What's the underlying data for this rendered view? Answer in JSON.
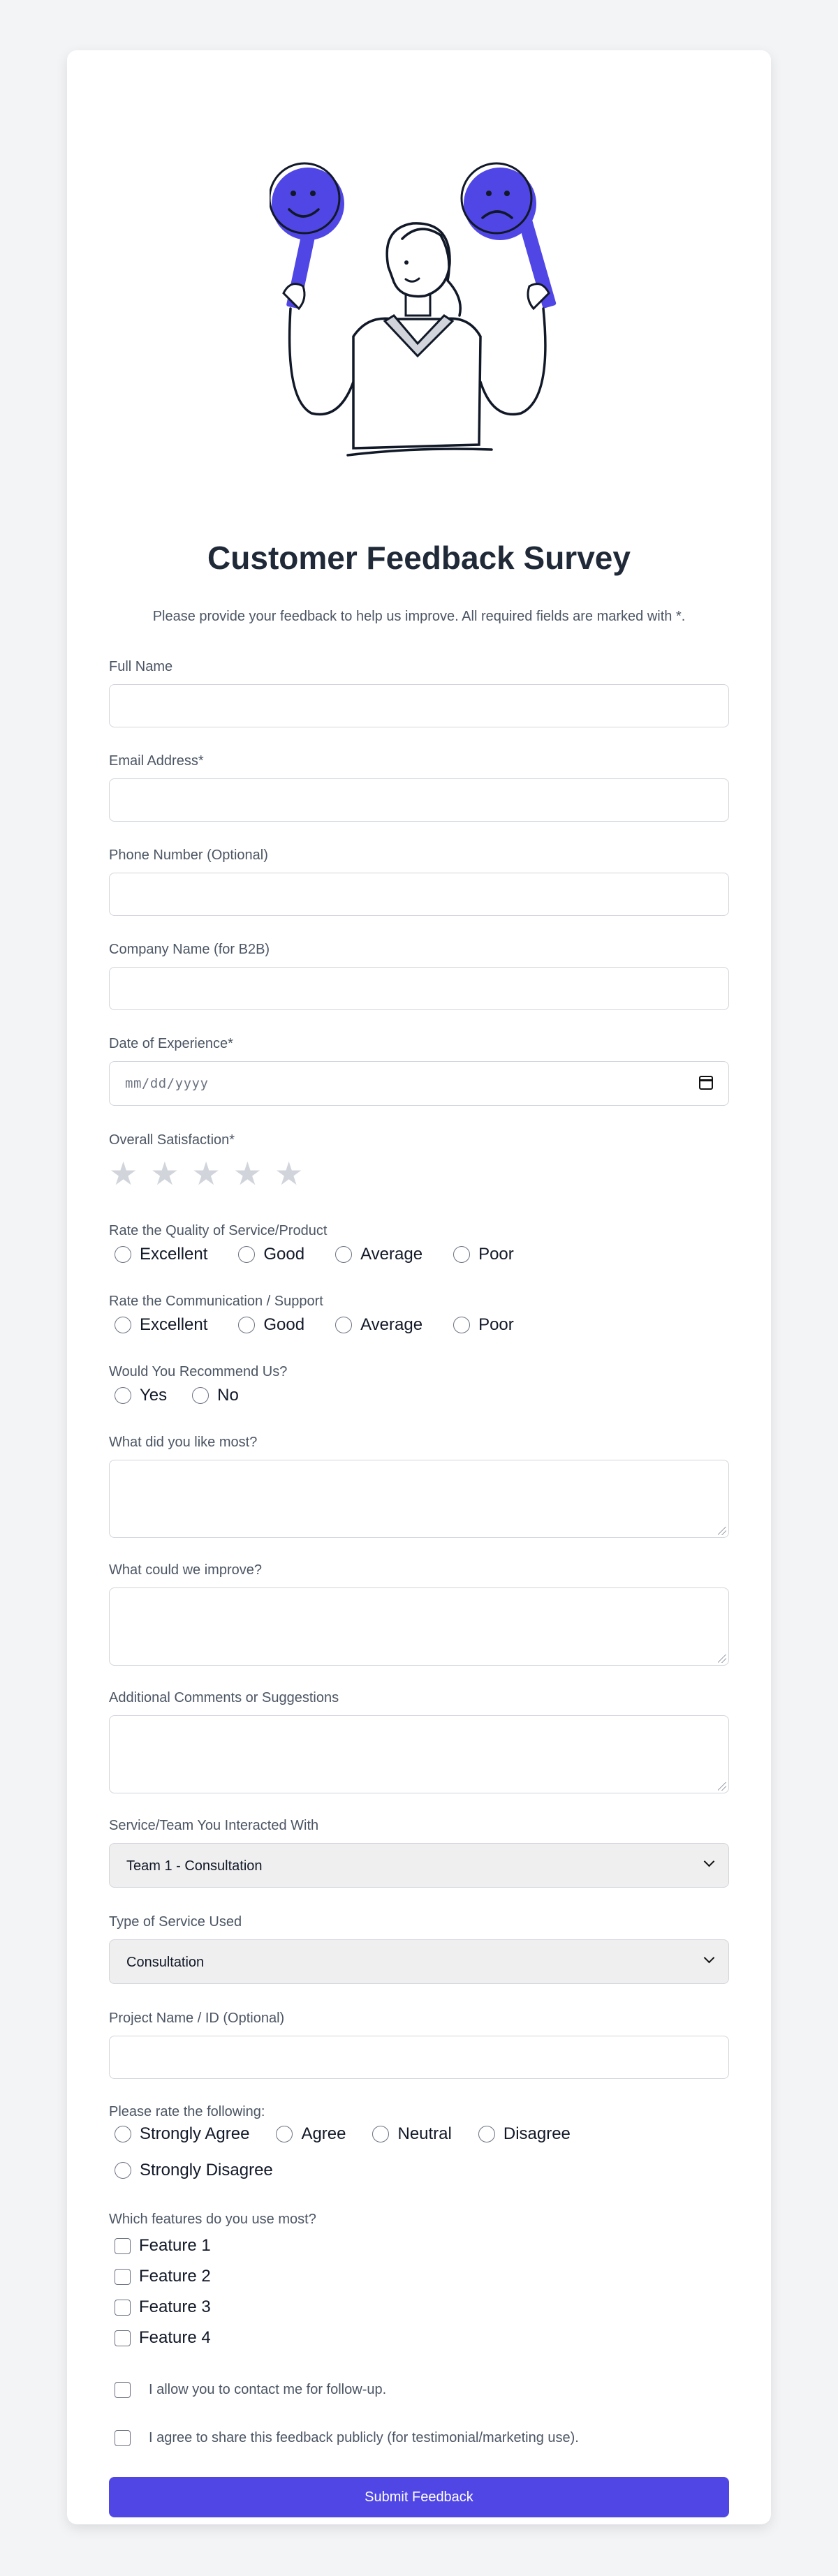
{
  "header": {
    "title": "Customer Feedback Survey",
    "subtitle": "Please provide your feedback to help us improve. All required fields are marked with *."
  },
  "fields": {
    "full_name": {
      "label": "Full Name",
      "value": ""
    },
    "email": {
      "label": "Email Address*",
      "value": ""
    },
    "phone": {
      "label": "Phone Number (Optional)",
      "value": ""
    },
    "company": {
      "label": "Company Name (for B2B)",
      "value": ""
    },
    "date": {
      "label": "Date of Experience*",
      "placeholder": "mm/dd/yyyy"
    },
    "satisfaction": {
      "label": "Overall Satisfaction*",
      "stars": 5,
      "rating": 0
    },
    "quality": {
      "label": "Rate the Quality of Service/Product",
      "options": [
        "Excellent",
        "Good",
        "Average",
        "Poor"
      ]
    },
    "communication": {
      "label": "Rate the Communication / Support",
      "options": [
        "Excellent",
        "Good",
        "Average",
        "Poor"
      ]
    },
    "recommend": {
      "label": "Would You Recommend Us?",
      "options": [
        "Yes",
        "No"
      ]
    },
    "liked": {
      "label": "What did you like most?",
      "value": ""
    },
    "improve": {
      "label": "What could we improve?",
      "value": ""
    },
    "comments": {
      "label": "Additional Comments or Suggestions",
      "value": ""
    },
    "team": {
      "label": "Service/Team You Interacted With",
      "selected": "Team 1 - Consultation"
    },
    "service_type": {
      "label": "Type of Service Used",
      "selected": "Consultation"
    },
    "project": {
      "label": "Project Name / ID (Optional)",
      "value": ""
    },
    "agreement": {
      "label": "Please rate the following:",
      "options": [
        "Strongly Agree",
        "Agree",
        "Neutral",
        "Disagree",
        "Strongly Disagree"
      ]
    },
    "features": {
      "label": "Which features do you use most?",
      "options": [
        "Feature 1",
        "Feature 2",
        "Feature 3",
        "Feature 4"
      ]
    },
    "consent_contact": {
      "label": "I allow you to contact me for follow-up."
    },
    "consent_public": {
      "label": "I agree to share this feedback publicly (for testimonial/marketing use)."
    }
  },
  "submit_label": "Submit Feedback",
  "colors": {
    "accent": "#4f46e5",
    "page_bg": "#f3f4f6",
    "card_bg": "#ffffff",
    "star_empty": "#d1d5db"
  },
  "icons": {
    "illustration": "person-holding-happy-and-sad-face-signs",
    "star": "star-icon",
    "calendar": "calendar-icon",
    "chevron": "chevron-down-icon"
  }
}
